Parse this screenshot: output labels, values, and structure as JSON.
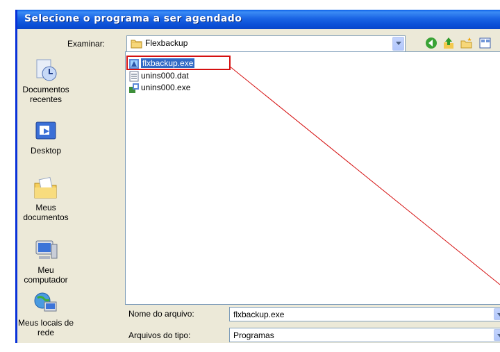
{
  "dialog": {
    "title": "Selecione o programa a ser agendado"
  },
  "lookin": {
    "label": "Examinar:",
    "value": "Flexbackup",
    "icon": "folder-icon"
  },
  "toolbar": {
    "icons": [
      "back-icon",
      "up-folder-icon",
      "new-folder-icon",
      "views-icon"
    ]
  },
  "places": [
    {
      "label": "Documentos recentes",
      "icon": "recent-documents-icon"
    },
    {
      "label": "Desktop",
      "icon": "desktop-icon"
    },
    {
      "label": "Meus documentos",
      "icon": "my-documents-icon"
    },
    {
      "label": "Meu computador",
      "icon": "my-computer-icon"
    },
    {
      "label": "Meus locais de rede",
      "icon": "network-places-icon"
    }
  ],
  "files": [
    {
      "name": "flxbackup.exe",
      "icon": "exe-icon",
      "selected": true
    },
    {
      "name": "unins000.dat",
      "icon": "dat-file-icon",
      "selected": false
    },
    {
      "name": "unins000.exe",
      "icon": "installer-icon",
      "selected": false
    }
  ],
  "filename": {
    "label": "Nome do arquivo:",
    "value": "flxbackup.exe"
  },
  "filetype": {
    "label": "Arquivos do tipo:",
    "value": "Programas"
  },
  "colors": {
    "titlebar": "#0b4fd6",
    "selection": "#316ac5",
    "annotation": "#d51010",
    "dialog_bg": "#ece9d8"
  }
}
